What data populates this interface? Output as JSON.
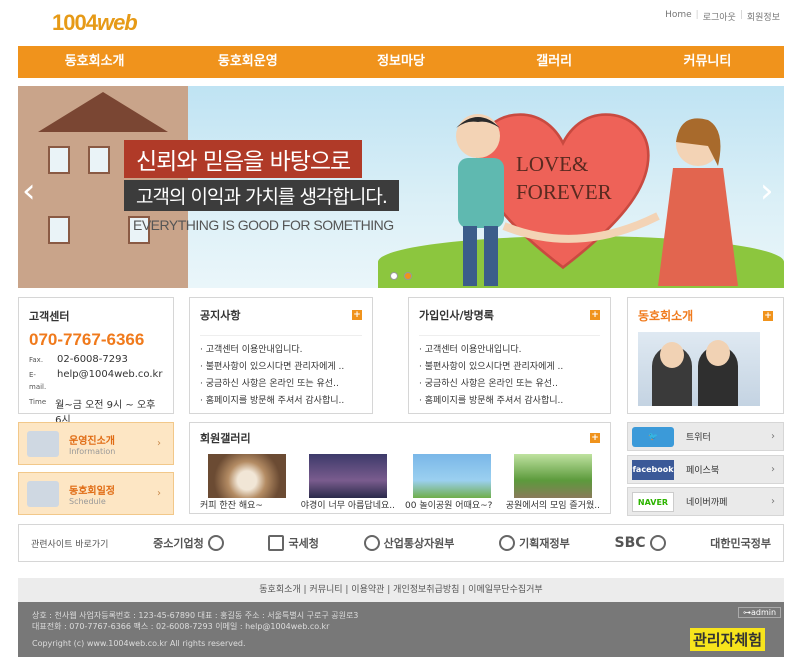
{
  "header": {
    "logo_prefix": "1004",
    "logo_suffix": "web",
    "topnav": [
      "Home",
      "로그아웃",
      "회원정보"
    ]
  },
  "gnb": [
    "동호회소개",
    "동호회운영",
    "정보마당",
    "갤러리",
    "커뮤니티"
  ],
  "banner": {
    "line1": "신뢰와 믿음을 바탕으로",
    "line2": "고객의 이익과 가치를 생각합니다.",
    "line3": "EVERYTHING IS GOOD FOR SOMETHING",
    "love1": "LOVE&",
    "love2": "FOREVER",
    "prev": "‹",
    "next": "›"
  },
  "cs": {
    "title": "고객센터",
    "tel": "070-7767-6366",
    "fax_label": "Fax.",
    "fax": "02-6008-7293",
    "email_label": "E-mail.",
    "email": "help@1004web.co.kr",
    "time_label": "Time",
    "time": "월~금 오전 9시 ~ 오후 6시"
  },
  "notice": {
    "title": "공지사항",
    "items": [
      "· 고객센터 이용안내입니다.",
      "· 불편사항이 있으시다면 관리자에게 ..",
      "· 궁금하신 사항은 온라인 또는 유선..",
      "· 홈페이지를 방문해 주셔서 감사합니.."
    ]
  },
  "greet": {
    "title": "가입인사/방명록",
    "items": [
      "· 고객센터 이용안내입니다.",
      "· 불편사항이 있으시다면 관리자에게 ..",
      "· 궁금하신 사항은 온라인 또는 유선..",
      "· 홈페이지를 방문해 주셔서 감사합니.."
    ]
  },
  "intro": {
    "title": "동호회소개"
  },
  "quick": [
    {
      "title": "운영진소개",
      "sub": "Information"
    },
    {
      "title": "동호회일정",
      "sub": "Schedule"
    }
  ],
  "gallery": {
    "title": "회원갤러리",
    "items": [
      "커피 한잔 해요~",
      "야경이 너무 아름답네요..",
      "00 놀이공원 어때요~?",
      "공원에서의 모임 즐거웠.."
    ]
  },
  "sns": [
    {
      "logo": "twitter",
      "label": "트위터",
      "color": "#3b9ad9"
    },
    {
      "logo": "facebook",
      "label": "페이스북",
      "color": "#3b5998"
    },
    {
      "logo": "NAVER",
      "label": "네이버까페",
      "color": "#2db400"
    }
  ],
  "related": {
    "title": "관련사이트 바로가기",
    "orgs": [
      "중소기업청",
      "국세청",
      "산업통상자원부",
      "기획재정부",
      "SBC",
      "대한민국정부"
    ]
  },
  "footer": {
    "links": "동호회소개 | 커뮤니티 | 이용약관 | 개인정보취급방침 | 이메일무단수집거부",
    "line1": "상호 : 천사웹   사업자등록번호 : 123-45-67890   대표 : 홍길동   주소 : 서울특별시 구로구 공원로3",
    "line2": "대표전화 : 070-7767-6366   팩스 : 02-6008-7293   이메일 : help@1004web.co.kr",
    "line3": "Copyright (c) www.1004web.co.kr All rights reserved.",
    "admin": "⊶admin",
    "experience": "관리자체험"
  }
}
